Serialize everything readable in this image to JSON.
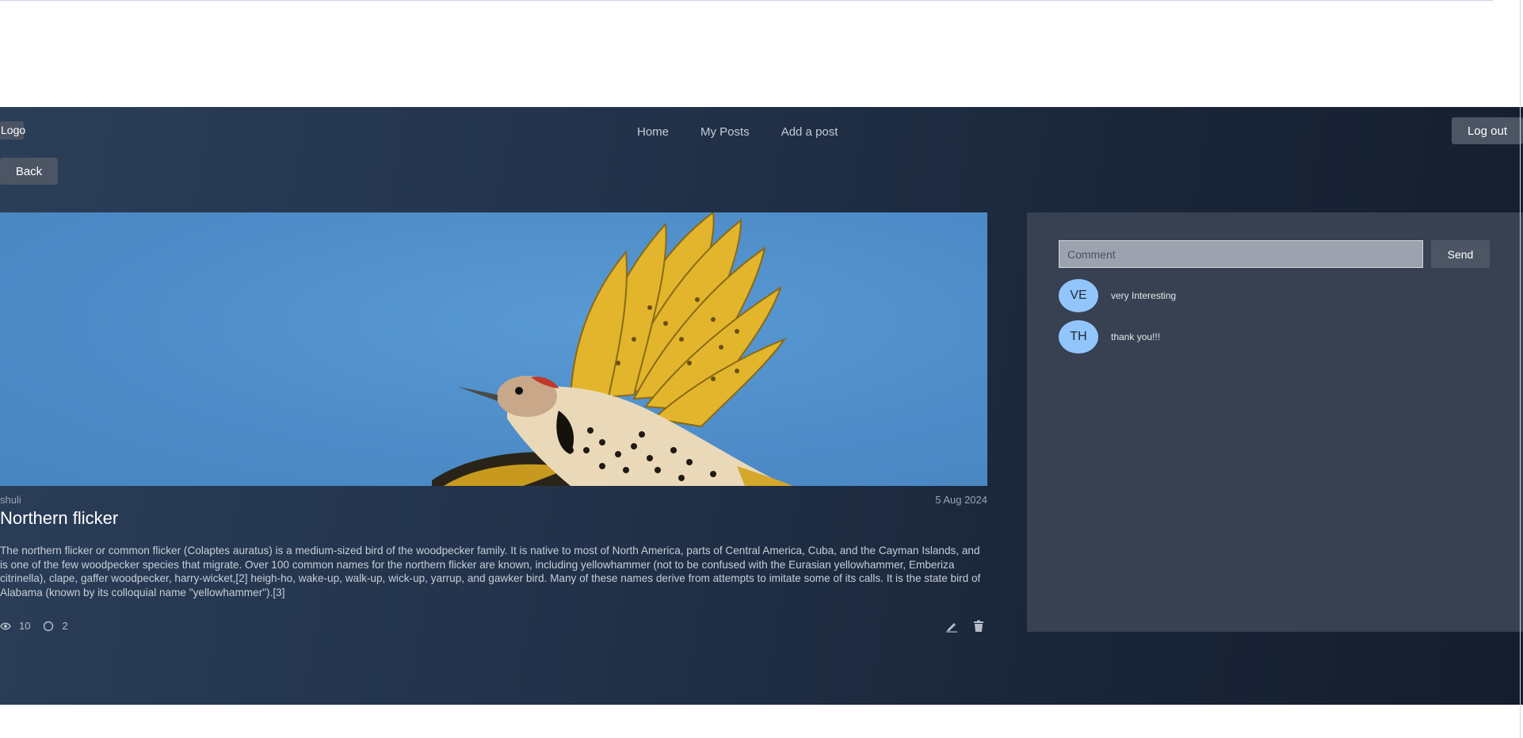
{
  "header": {
    "logo": "Logo",
    "nav": [
      "Home",
      "My Posts",
      "Add a post"
    ],
    "logout_label": "Log out"
  },
  "back_label": "Back",
  "post": {
    "author": "shuli",
    "date": "5 Aug 2024",
    "title": "Northern flicker",
    "body": "The northern flicker or common flicker (Colaptes auratus) is a medium-sized bird of the woodpecker family. It is native to most of North America, parts of Central America, Cuba, and the Cayman Islands, and is one of the few woodpecker species that migrate. Over 100 common names for the northern flicker are known, including yellowhammer (not to be confused with the Eurasian yellowhammer, Emberiza citrinella), clape, gaffer woodpecker, harry-wicket,[2] heigh-ho, wake-up, walk-up, wick-up, yarrup, and gawker bird. Many of these names derive from attempts to imitate some of its calls. It is the state bird of Alabama (known by its colloquial name \"yellowhammer\").[3]",
    "views": "10",
    "comments_count": "2",
    "image_icon": "northern-flicker-photo"
  },
  "comments": {
    "placeholder": "Comment",
    "send_label": "Send",
    "items": [
      {
        "initials": "VE",
        "text": "very Interesting"
      },
      {
        "initials": "TH",
        "text": "thank you!!!"
      }
    ]
  },
  "colors": {
    "background": "#1f2d42",
    "panel": "#374151",
    "avatar": "#93c5fd",
    "button": "#4b5563"
  }
}
